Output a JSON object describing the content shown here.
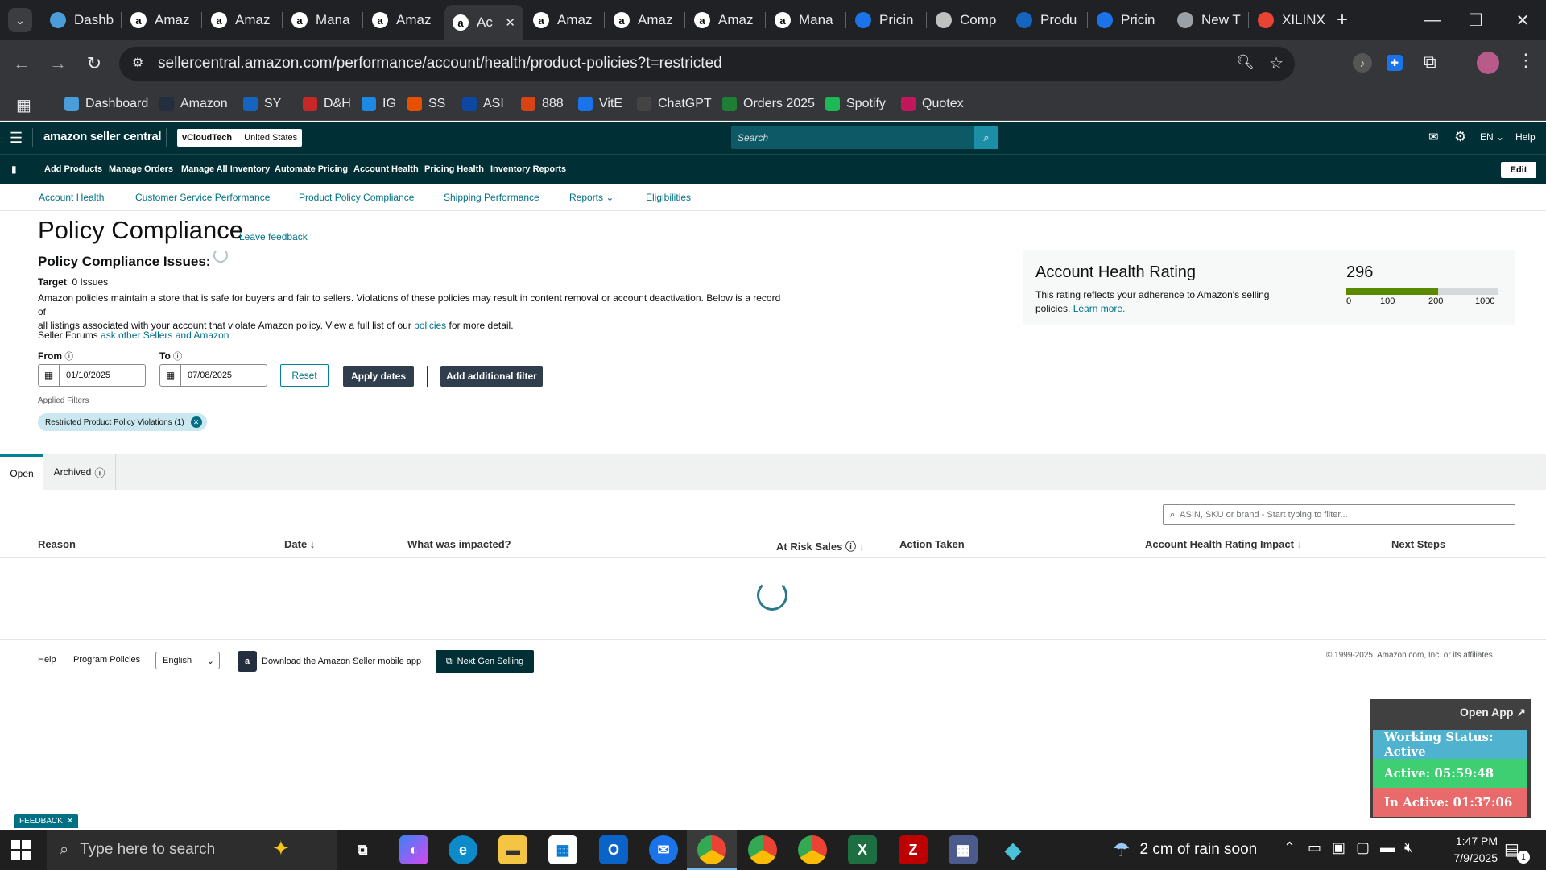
{
  "browser": {
    "tabs": [
      {
        "title": "Dashb",
        "icon": "dashboard-favicon",
        "color": "#4a9dd9"
      },
      {
        "title": "Amaz",
        "icon": "amazon-favicon",
        "color": "#ffffff"
      },
      {
        "title": "Amaz",
        "icon": "amazon-favicon",
        "color": "#ffffff"
      },
      {
        "title": "Mana",
        "icon": "amazon-favicon",
        "color": "#ffffff"
      },
      {
        "title": "Amaz",
        "icon": "amazon-favicon",
        "color": "#ffffff"
      },
      {
        "title": "Ac",
        "icon": "amazon-favicon",
        "color": "#ffffff"
      },
      {
        "title": "Amaz",
        "icon": "amazon-favicon",
        "color": "#ffffff"
      },
      {
        "title": "Amaz",
        "icon": "amazon-favicon",
        "color": "#ffffff"
      },
      {
        "title": "Amaz",
        "icon": "amazon-favicon",
        "color": "#ffffff"
      },
      {
        "title": "Mana",
        "icon": "amazon-favicon",
        "color": "#ffffff"
      },
      {
        "title": "Pricin",
        "icon": "pricing-favicon",
        "color": "#1a73e8"
      },
      {
        "title": "Comp",
        "icon": "chart-favicon",
        "color": "#c0c0c0"
      },
      {
        "title": "Produ",
        "icon": "ec-favicon",
        "color": "#1565c0"
      },
      {
        "title": "Pricin",
        "icon": "pricing-favicon",
        "color": "#1a73e8"
      },
      {
        "title": "New T",
        "icon": "chrome-favicon",
        "color": "#9aa0a6"
      },
      {
        "title": "XILINX",
        "icon": "google-favicon",
        "color": "#ea4335"
      }
    ],
    "url": "sellercentral.amazon.com/performance/account/health/product-policies?t=restricted",
    "bookmarks": [
      {
        "label": "Dashboard",
        "color": "#4a9dd9"
      },
      {
        "label": "Amazon",
        "color": "#232f3e"
      },
      {
        "label": "SY",
        "color": "#1565c0"
      },
      {
        "label": "D&H",
        "color": "#c62828"
      },
      {
        "label": "IG",
        "color": "#1e88e5"
      },
      {
        "label": "SS",
        "color": "#e65100"
      },
      {
        "label": "ASI",
        "color": "#0d47a1"
      },
      {
        "label": "888",
        "color": "#d84315"
      },
      {
        "label": "VitE",
        "color": "#1a73e8"
      },
      {
        "label": "ChatGPT",
        "color": "#444444"
      },
      {
        "label": "Orders 2025",
        "color": "#1e7e34"
      },
      {
        "label": "Spotify",
        "color": "#1db954"
      },
      {
        "label": "Quotex",
        "color": "#c2185b"
      }
    ]
  },
  "seller_central": {
    "logo": "amazon seller central",
    "store": "vCloudTech",
    "marketplace": "United States",
    "search_placeholder": "Search",
    "language": "EN",
    "help": "Help",
    "edit": "Edit",
    "nav": [
      "Add Products",
      "Manage Orders",
      "Manage All Inventory",
      "Automate Pricing",
      "Account Health",
      "Pricing Health",
      "Inventory Reports"
    ],
    "subnav": [
      "Account Health",
      "Customer Service Performance",
      "Product Policy Compliance",
      "Shipping Performance",
      "Reports",
      "Eligibilities"
    ]
  },
  "page": {
    "title": "Policy Compliance",
    "leave_feedback": "Leave feedback",
    "issues_heading": "Policy Compliance Issues:",
    "target_label": "Target",
    "target_value": ": 0 Issues",
    "description_1": "Amazon policies maintain a store that is safe for buyers and fair to sellers. Violations of these policies may result in content removal or account deactivation. Below is a record of",
    "description_2": "all listings associated with your account that violate Amazon policy. View a full list of our",
    "policies_link": "policies",
    "description_3": "for more detail.",
    "forums_label": "Seller Forums",
    "forums_link": "ask other Sellers and Amazon",
    "from_label": "From",
    "to_label": "To",
    "from_date": "01/10/2025",
    "to_date": "07/08/2025",
    "reset": "Reset",
    "apply": "Apply dates",
    "add_filter": "Add additional filter",
    "applied_filters_label": "Applied Filters",
    "filter_chip": "Restricted Product Policy Violations (1)",
    "tabs": [
      "Open",
      "Archived"
    ],
    "filter_placeholder": "ASIN, SKU or brand - Start typing to filter...",
    "columns": [
      "Reason",
      "Date",
      "What was impacted?",
      "At Risk Sales",
      "Action Taken",
      "Account Health Rating Impact",
      "Next Steps"
    ]
  },
  "ahr": {
    "title": "Account Health Rating",
    "description": "This rating reflects your adherence to Amazon's selling policies.",
    "learn_more": "Learn more.",
    "score": "296",
    "score_value": 296,
    "scale": [
      "0",
      "100",
      "200",
      "1000"
    ],
    "color_good": "#5a8a00"
  },
  "footer": {
    "help": "Help",
    "program_policies": "Program Policies",
    "language": "English",
    "mobile_app": "Download the Amazon Seller mobile app",
    "next_gen": "Next Gen Selling",
    "copyright": "© 1999-2025, Amazon.com, Inc. or its affiliates",
    "feedback": "FEEDBACK"
  },
  "widget": {
    "open_app": "Open App ↗",
    "working_status": "Working Status: Active",
    "active": "Active: 05:59:48",
    "inactive": "In Active: 01:37:06",
    "colors": {
      "status": "#4fb3cf",
      "active": "#3ecf72",
      "inactive": "#e86a6a"
    }
  },
  "taskbar": {
    "search_placeholder": "Type here to search",
    "weather": "2 cm of rain soon",
    "time": "1:47 PM",
    "date": "7/9/2025",
    "notifications": "1"
  }
}
